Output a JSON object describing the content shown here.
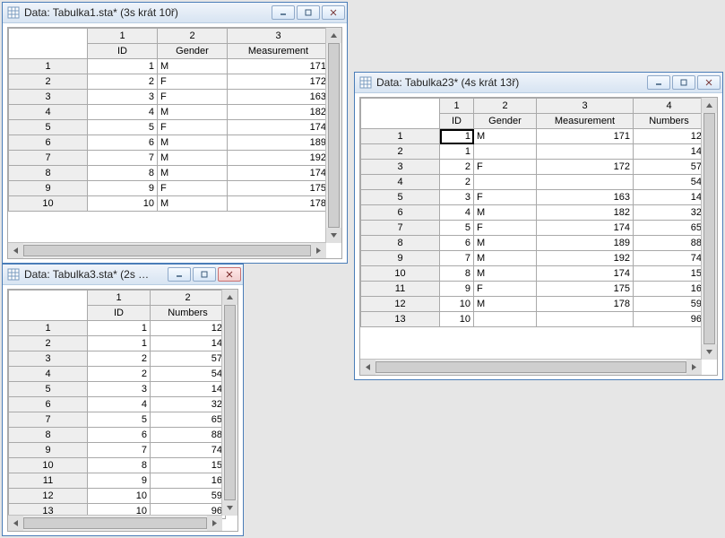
{
  "windows": {
    "w1": {
      "title": "Data: Tabulka1.sta* (3s krát 10ř)",
      "columns": [
        {
          "num": "1",
          "label": "ID"
        },
        {
          "num": "2",
          "label": "Gender"
        },
        {
          "num": "3",
          "label": "Measurement"
        }
      ],
      "rows": [
        {
          "n": "1",
          "ID": "1",
          "Gender": "M",
          "Measurement": "171"
        },
        {
          "n": "2",
          "ID": "2",
          "Gender": "F",
          "Measurement": "172"
        },
        {
          "n": "3",
          "ID": "3",
          "Gender": "F",
          "Measurement": "163"
        },
        {
          "n": "4",
          "ID": "4",
          "Gender": "M",
          "Measurement": "182"
        },
        {
          "n": "5",
          "ID": "5",
          "Gender": "F",
          "Measurement": "174"
        },
        {
          "n": "6",
          "ID": "6",
          "Gender": "M",
          "Measurement": "189"
        },
        {
          "n": "7",
          "ID": "7",
          "Gender": "M",
          "Measurement": "192"
        },
        {
          "n": "8",
          "ID": "8",
          "Gender": "M",
          "Measurement": "174"
        },
        {
          "n": "9",
          "ID": "9",
          "Gender": "F",
          "Measurement": "175"
        },
        {
          "n": "10",
          "ID": "10",
          "Gender": "M",
          "Measurement": "178"
        }
      ]
    },
    "w2": {
      "title": "Data: Tabulka3.sta* (2s …",
      "columns": [
        {
          "num": "1",
          "label": "ID"
        },
        {
          "num": "2",
          "label": "Numbers"
        }
      ],
      "rows": [
        {
          "n": "1",
          "ID": "1",
          "Numbers": "12"
        },
        {
          "n": "2",
          "ID": "1",
          "Numbers": "14"
        },
        {
          "n": "3",
          "ID": "2",
          "Numbers": "57"
        },
        {
          "n": "4",
          "ID": "2",
          "Numbers": "54"
        },
        {
          "n": "5",
          "ID": "3",
          "Numbers": "14"
        },
        {
          "n": "6",
          "ID": "4",
          "Numbers": "32"
        },
        {
          "n": "7",
          "ID": "5",
          "Numbers": "65"
        },
        {
          "n": "8",
          "ID": "6",
          "Numbers": "88"
        },
        {
          "n": "9",
          "ID": "7",
          "Numbers": "74"
        },
        {
          "n": "10",
          "ID": "8",
          "Numbers": "15"
        },
        {
          "n": "11",
          "ID": "9",
          "Numbers": "16"
        },
        {
          "n": "12",
          "ID": "10",
          "Numbers": "59"
        },
        {
          "n": "13",
          "ID": "10",
          "Numbers": "96"
        }
      ]
    },
    "w3": {
      "title": "Data: Tabulka23* (4s krát 13ř)",
      "columns": [
        {
          "num": "1",
          "label": "ID"
        },
        {
          "num": "2",
          "label": "Gender"
        },
        {
          "num": "3",
          "label": "Measurement"
        },
        {
          "num": "4",
          "label": "Numbers"
        }
      ],
      "rows": [
        {
          "n": "1",
          "ID": "1",
          "Gender": "M",
          "Measurement": "171",
          "Numbers": "12"
        },
        {
          "n": "2",
          "ID": "1",
          "Gender": "",
          "Measurement": "",
          "Numbers": "14"
        },
        {
          "n": "3",
          "ID": "2",
          "Gender": "F",
          "Measurement": "172",
          "Numbers": "57"
        },
        {
          "n": "4",
          "ID": "2",
          "Gender": "",
          "Measurement": "",
          "Numbers": "54"
        },
        {
          "n": "5",
          "ID": "3",
          "Gender": "F",
          "Measurement": "163",
          "Numbers": "14"
        },
        {
          "n": "6",
          "ID": "4",
          "Gender": "M",
          "Measurement": "182",
          "Numbers": "32"
        },
        {
          "n": "7",
          "ID": "5",
          "Gender": "F",
          "Measurement": "174",
          "Numbers": "65"
        },
        {
          "n": "8",
          "ID": "6",
          "Gender": "M",
          "Measurement": "189",
          "Numbers": "88"
        },
        {
          "n": "9",
          "ID": "7",
          "Gender": "M",
          "Measurement": "192",
          "Numbers": "74"
        },
        {
          "n": "10",
          "ID": "8",
          "Gender": "M",
          "Measurement": "174",
          "Numbers": "15"
        },
        {
          "n": "11",
          "ID": "9",
          "Gender": "F",
          "Measurement": "175",
          "Numbers": "16"
        },
        {
          "n": "12",
          "ID": "10",
          "Gender": "M",
          "Measurement": "178",
          "Numbers": "59"
        },
        {
          "n": "13",
          "ID": "10",
          "Gender": "",
          "Measurement": "",
          "Numbers": "96"
        }
      ]
    }
  }
}
